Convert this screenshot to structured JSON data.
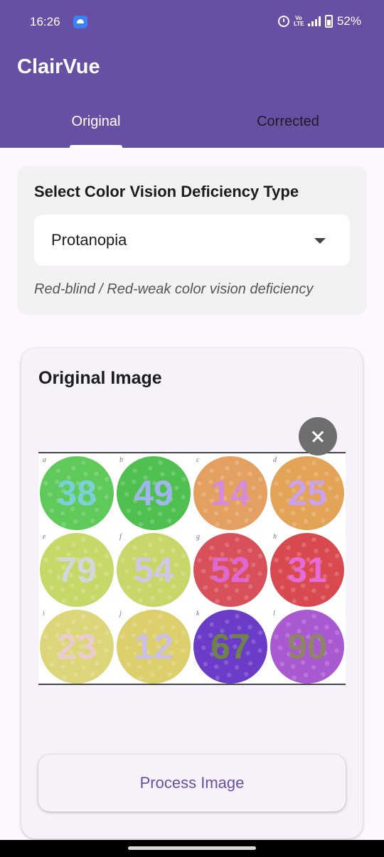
{
  "status_bar": {
    "time": "16:26",
    "volte": "Vo LTE",
    "battery": "52%",
    "icons": [
      "android-app-icon",
      "alarm-icon",
      "volte-icon",
      "signal-icon",
      "battery-icon"
    ]
  },
  "app": {
    "title": "ClairVue"
  },
  "tabs": [
    {
      "label": "Original",
      "selected": true
    },
    {
      "label": "Corrected",
      "selected": false
    }
  ],
  "deficiency": {
    "heading": "Select Color Vision Deficiency Type",
    "selected": "Protanopia",
    "description": "Red-blind / Red-weak color vision deficiency"
  },
  "image_card": {
    "title": "Original Image",
    "process_label": "Process Image",
    "plates": [
      {
        "letter": "a",
        "number": "38",
        "bg": "#5fc95a",
        "fg": "#7fd0e6"
      },
      {
        "letter": "b",
        "number": "49",
        "bg": "#4fc04f",
        "fg": "#a8b6ff"
      },
      {
        "letter": "c",
        "number": "14",
        "bg": "#e4a060",
        "fg": "#d48ae6"
      },
      {
        "letter": "d",
        "number": "25",
        "bg": "#e3a458",
        "fg": "#c9a0ff"
      },
      {
        "letter": "e",
        "number": "79",
        "bg": "#c8d868",
        "fg": "#d4d7e8"
      },
      {
        "letter": "f",
        "number": "54",
        "bg": "#c8d66a",
        "fg": "#d2c6f2"
      },
      {
        "letter": "g",
        "number": "52",
        "bg": "#d8505a",
        "fg": "#e06ae0"
      },
      {
        "letter": "h",
        "number": "31",
        "bg": "#d84a50",
        "fg": "#e86fe6"
      },
      {
        "letter": "i",
        "number": "23",
        "bg": "#dcd67a",
        "fg": "#eccbd8"
      },
      {
        "letter": "j",
        "number": "12",
        "bg": "#dccf6c",
        "fg": "#c7bff2"
      },
      {
        "letter": "k",
        "number": "67",
        "bg": "#6a3cc8",
        "fg": "#6f8a3a"
      },
      {
        "letter": "l",
        "number": "90",
        "bg": "#a95ad0",
        "fg": "#8a8a5a"
      }
    ]
  },
  "colors": {
    "primary": "#6750a4",
    "surface": "#fcf8fd"
  }
}
